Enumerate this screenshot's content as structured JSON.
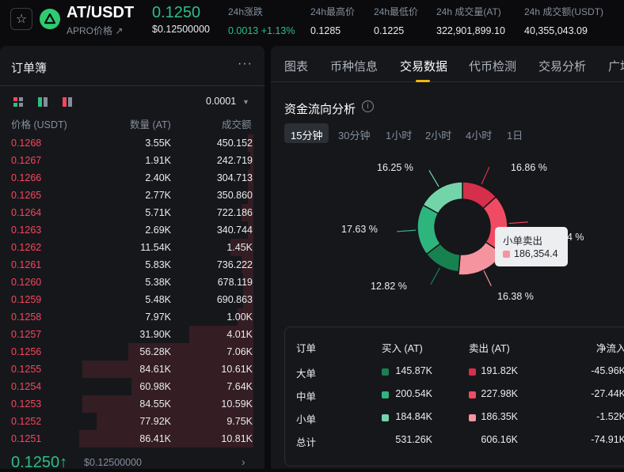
{
  "header": {
    "pair": "AT/USDT",
    "pair_sub": "APRO价格 ↗",
    "last_price": "0.1250",
    "last_price_usd": "$0.12500000",
    "stats": [
      {
        "label": "24h涨跌",
        "value": "0.0013 +1.13%"
      },
      {
        "label": "24h最高价",
        "value": "0.1285"
      },
      {
        "label": "24h最低价",
        "value": "0.1225"
      },
      {
        "label": "24h 成交量(AT)",
        "value": "322,901,899.10"
      },
      {
        "label": "24h 成交额(USDT)",
        "value": "40,355,043.09"
      }
    ]
  },
  "orderbook": {
    "title": "订单簿",
    "more": "···",
    "precision": "0.0001",
    "col_price": "价格 (USDT)",
    "col_qty": "数量 (AT)",
    "col_turnover": "成交额",
    "rows": [
      {
        "price": "0.1268",
        "qty": "3.55K",
        "total": "450.152",
        "depth": 0.03
      },
      {
        "price": "0.1267",
        "qty": "1.91K",
        "total": "242.719",
        "depth": 0.02
      },
      {
        "price": "0.1266",
        "qty": "2.40K",
        "total": "304.713",
        "depth": 0.03
      },
      {
        "price": "0.1265",
        "qty": "2.77K",
        "total": "350.860",
        "depth": 0.03
      },
      {
        "price": "0.1264",
        "qty": "5.71K",
        "total": "722.186",
        "depth": 0.07
      },
      {
        "price": "0.1263",
        "qty": "2.69K",
        "total": "340.744",
        "depth": 0.03
      },
      {
        "price": "0.1262",
        "qty": "11.54K",
        "total": "1.45K",
        "depth": 0.13
      },
      {
        "price": "0.1261",
        "qty": "5.83K",
        "total": "736.222",
        "depth": 0.07
      },
      {
        "price": "0.1260",
        "qty": "5.38K",
        "total": "678.119",
        "depth": 0.06
      },
      {
        "price": "0.1259",
        "qty": "5.48K",
        "total": "690.863",
        "depth": 0.06
      },
      {
        "price": "0.1258",
        "qty": "7.97K",
        "total": "1.00K",
        "depth": 0.09
      },
      {
        "price": "0.1257",
        "qty": "31.90K",
        "total": "4.01K",
        "depth": 0.37
      },
      {
        "price": "0.1256",
        "qty": "56.28K",
        "total": "7.06K",
        "depth": 0.72
      },
      {
        "price": "0.1255",
        "qty": "84.61K",
        "total": "10.61K",
        "depth": 0.98
      },
      {
        "price": "0.1254",
        "qty": "60.98K",
        "total": "7.64K",
        "depth": 0.7
      },
      {
        "price": "0.1253",
        "qty": "84.55K",
        "total": "10.59K",
        "depth": 0.98
      },
      {
        "price": "0.1252",
        "qty": "77.92K",
        "total": "9.75K",
        "depth": 0.9
      },
      {
        "price": "0.1251",
        "qty": "86.41K",
        "total": "10.81K",
        "depth": 1.0
      }
    ],
    "mid_price": "0.1250↑",
    "mid_usd": "$0.12500000",
    "mid_arrow": "›"
  },
  "panel": {
    "tabs": [
      "图表",
      "币种信息",
      "交易数据",
      "代币检测",
      "交易分析",
      "广场"
    ],
    "active_tab": 2,
    "section_title": "资金流向分析",
    "info_icon": "i",
    "timeframes": [
      "15分钟",
      "30分钟",
      "1小时",
      "2小时",
      "4小时",
      "1日"
    ],
    "active_timeframe": 0,
    "donut_labels": [
      "16.86 %",
      "4 %",
      "16.38 %",
      "12.82 %",
      "17.63 %",
      "16.25 %"
    ],
    "tooltip": {
      "title": "小单卖出",
      "value": "186,354.4"
    },
    "table": {
      "headers": [
        "订单",
        "买入 (AT)",
        "卖出 (AT)",
        "净流入"
      ],
      "rows": [
        {
          "name": "大单",
          "buy": "145.87K",
          "sell": "191.82K",
          "net": "-45.96K"
        },
        {
          "name": "中单",
          "buy": "200.54K",
          "sell": "227.98K",
          "net": "-27.44K"
        },
        {
          "name": "小单",
          "buy": "184.84K",
          "sell": "186.35K",
          "net": "-1.52K"
        },
        {
          "name": "总计",
          "buy": "531.26K",
          "sell": "606.16K",
          "net": "-74.91K"
        }
      ]
    }
  },
  "colors": {
    "green": "#2ebd85",
    "red": "#f6465d",
    "large_buy": "#17814f",
    "medium_buy": "#2eb57e",
    "small_buy": "#74d4a9",
    "large_sell": "#d62f4b",
    "medium_sell": "#f14b63",
    "small_sell": "#f5949e",
    "accent": "#f0b90b"
  },
  "chart_data": {
    "type": "pie",
    "title": "资金流向分析",
    "categories": [
      "大单卖出",
      "中单卖出",
      "小单卖出",
      "大单买入",
      "中单买入",
      "小单买入"
    ],
    "values": [
      145.87,
      227.98,
      186.35,
      145.87,
      200.54,
      184.84
    ],
    "percent_labels": [
      "16.86 %",
      "?",
      "16.38 %",
      "12.82 %",
      "17.63 %",
      "16.25 %"
    ]
  }
}
